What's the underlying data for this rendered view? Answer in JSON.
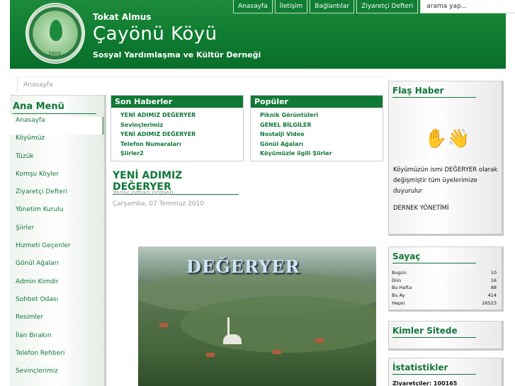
{
  "header": {
    "small_title": "Tokat Almus",
    "big_title": "Çayönü Köyü",
    "subtitle": "Sosyal Yardımlaşma ve Kültür Derneği",
    "logo_year": "2003"
  },
  "topnav": {
    "items": [
      "Anasayfa",
      "İletişim",
      "Bağlantılar",
      "Ziyaretçi Defteri"
    ],
    "search_placeholder": "arama yap..."
  },
  "breadcrumb": "Anasayfa",
  "leftmenu": {
    "title": "Ana Menü",
    "items": [
      "Anasayfa",
      "Köyümüz",
      "Tüzük",
      "Komşu Köyler",
      "Ziyaretçi Defteri",
      "Yönetim Kurulu",
      "Şiirler",
      "Hizmeti Geçenler",
      "Gönül Ağaları",
      "Admin Kimdir",
      "Sohbet Odası",
      "Resimler",
      "İlan Bırakın",
      "Telefon Rehberi",
      "Sevinçlerimiz"
    ]
  },
  "news": {
    "title": "Son Haberler",
    "items": [
      "YENİ ADIMIZ DEĞERYER",
      "Sevinçlerimiz",
      "YENİ ADIMIZ DEĞERYER",
      "Telefon Numaraları",
      "Şiirler2"
    ]
  },
  "popular": {
    "title": "Popüler",
    "items": [
      "Piknik Görüntüleri",
      "GENEL BİLGİLER",
      "Nostalji Video",
      "Gönül Ağaları",
      "Köyümüzle ilgili Şiirler"
    ]
  },
  "article": {
    "title": "YENİ ADIMIZ DEĞERYER",
    "author": "Yazar orhan özmen",
    "date": "Çarşamba, 07 Temmuz 2010",
    "photo_caption": "DEĞERYER"
  },
  "flash": {
    "title": "Flaş Haber",
    "icon": "waving-hands-icon",
    "message": "Köyümüzün ismi DEĞERYER olarak değişmiştir tüm üyelerimize duyurulur",
    "signature": "DERNEK YÖNETİMİ"
  },
  "counter": {
    "title": "Sayaç",
    "rows": [
      {
        "label": "Bugün",
        "value": "10"
      },
      {
        "label": "Dün",
        "value": "16"
      },
      {
        "label": "Bu Hafta",
        "value": "88"
      },
      {
        "label": "Bu Ay",
        "value": "414"
      },
      {
        "label": "Hepsi",
        "value": "26523"
      }
    ]
  },
  "whoson": {
    "title": "Kimler Sitede"
  },
  "stats": {
    "title": "İstatistikler",
    "visitors": "Ziyaretçiler: 100165"
  },
  "colors": {
    "brand_green": "#0f7d33",
    "text_green": "#11773a"
  }
}
